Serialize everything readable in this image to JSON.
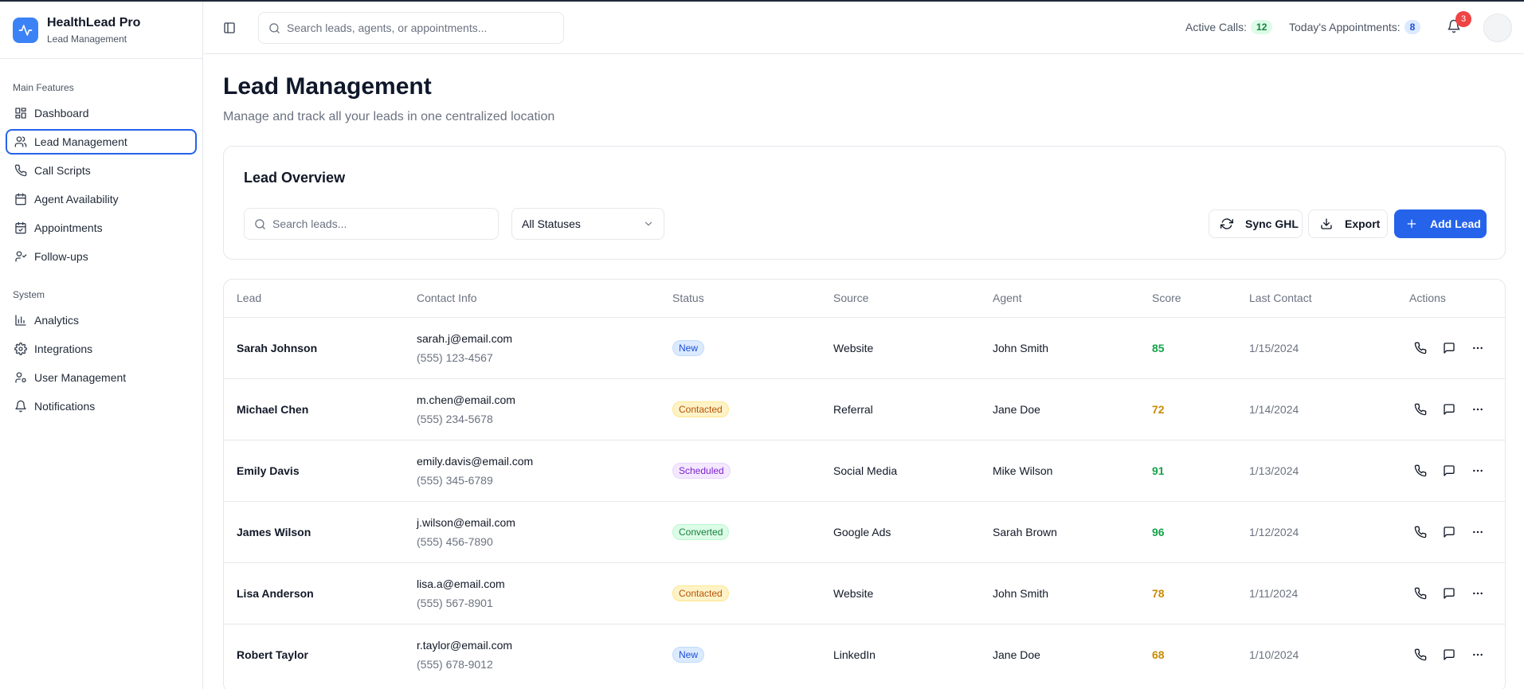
{
  "app": {
    "name": "HealthLead Pro",
    "subtitle": "Lead Management"
  },
  "sidebar": {
    "groups": [
      {
        "label": "Main Features",
        "items": [
          {
            "label": "Dashboard",
            "icon": "dashboard-icon"
          },
          {
            "label": "Lead Management",
            "icon": "users-icon",
            "active": true
          },
          {
            "label": "Call Scripts",
            "icon": "phone-icon"
          },
          {
            "label": "Agent Availability",
            "icon": "calendar-icon"
          },
          {
            "label": "Appointments",
            "icon": "calendar-check-icon"
          },
          {
            "label": "Follow-ups",
            "icon": "user-clock-icon"
          }
        ]
      },
      {
        "label": "System",
        "items": [
          {
            "label": "Analytics",
            "icon": "bar-chart-icon"
          },
          {
            "label": "Integrations",
            "icon": "gear-icon"
          },
          {
            "label": "User Management",
            "icon": "user-cog-icon"
          },
          {
            "label": "Notifications",
            "icon": "bell-icon"
          }
        ]
      }
    ]
  },
  "header": {
    "search_placeholder": "Search leads, agents, or appointments...",
    "active_calls_label": "Active Calls:",
    "active_calls_value": "12",
    "appointments_label": "Today's Appointments:",
    "appointments_value": "8",
    "notification_count": "3"
  },
  "page": {
    "title": "Lead Management",
    "subtitle": "Manage and track all your leads in one centralized location"
  },
  "overview": {
    "title": "Lead Overview",
    "search_placeholder": "Search leads...",
    "status_filter": "All Statuses",
    "sync_label": "Sync GHL",
    "export_label": "Export",
    "add_label": "Add Lead"
  },
  "table": {
    "columns": [
      "Lead",
      "Contact Info",
      "Status",
      "Source",
      "Agent",
      "Score",
      "Last Contact",
      "Actions"
    ],
    "rows": [
      {
        "name": "Sarah Johnson",
        "email": "sarah.j@email.com",
        "phone": "(555) 123-4567",
        "status": "New",
        "source": "Website",
        "agent": "John Smith",
        "score": "85",
        "last_contact": "1/15/2024"
      },
      {
        "name": "Michael Chen",
        "email": "m.chen@email.com",
        "phone": "(555) 234-5678",
        "status": "Contacted",
        "source": "Referral",
        "agent": "Jane Doe",
        "score": "72",
        "last_contact": "1/14/2024"
      },
      {
        "name": "Emily Davis",
        "email": "emily.davis@email.com",
        "phone": "(555) 345-6789",
        "status": "Scheduled",
        "source": "Social Media",
        "agent": "Mike Wilson",
        "score": "91",
        "last_contact": "1/13/2024"
      },
      {
        "name": "James Wilson",
        "email": "j.wilson@email.com",
        "phone": "(555) 456-7890",
        "status": "Converted",
        "source": "Google Ads",
        "agent": "Sarah Brown",
        "score": "96",
        "last_contact": "1/12/2024"
      },
      {
        "name": "Lisa Anderson",
        "email": "lisa.a@email.com",
        "phone": "(555) 567-8901",
        "status": "Contacted",
        "source": "Website",
        "agent": "John Smith",
        "score": "78",
        "last_contact": "1/11/2024"
      },
      {
        "name": "Robert Taylor",
        "email": "r.taylor@email.com",
        "phone": "(555) 678-9012",
        "status": "New",
        "source": "LinkedIn",
        "agent": "Jane Doe",
        "score": "68",
        "last_contact": "1/10/2024"
      }
    ]
  },
  "colors": {
    "accent": "#2563eb",
    "brand": "#3b82f6",
    "score_high": "#16a34a",
    "score_mid": "#ca8a04"
  }
}
